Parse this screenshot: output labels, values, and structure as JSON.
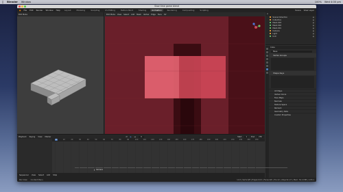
{
  "menubar": {
    "app": "Blender",
    "menu": "Window",
    "right": [
      "100%",
      "Wed 4:00 pm"
    ]
  },
  "window": {
    "title": "Slow time game blend"
  },
  "topbar": {
    "menus": [
      "File",
      "Edit",
      "Render",
      "Window",
      "Help"
    ],
    "workspaces": [
      "Layout",
      "Modeling",
      "Sculpting",
      "UV Editing",
      "Texture Paint",
      "Shading",
      "Animation",
      "Rendering",
      "Compositing",
      "Scripting"
    ],
    "active_workspace": "Animation",
    "scene": "Scene",
    "view_layer": "View Layer"
  },
  "leftview": {
    "mode": "Edit Mode"
  },
  "camview": {
    "mode": "Edit Mode",
    "menus": [
      "View",
      "Select",
      "Add",
      "Mesh",
      "Vertex",
      "Edge",
      "Face",
      "UV"
    ],
    "overlay_title": "Camera Perspective",
    "overlay_sub": "(0) Unit"
  },
  "outliner": {
    "items": [
      {
        "label": "Scene Collection",
        "green": false
      },
      {
        "label": "Collection",
        "green": false
      },
      {
        "label": "Mesh.003",
        "green": true
      },
      {
        "label": "Mesh.002",
        "green": true
      },
      {
        "label": "Mesh.001",
        "green": true
      },
      {
        "label": "Camera",
        "green": false
      },
      {
        "label": "Light",
        "green": false
      },
      {
        "label": "Unit",
        "green": true
      }
    ]
  },
  "props": {
    "object": "Cube",
    "data_name": "Base",
    "sections": [
      "Vertex Groups",
      "Shape Keys"
    ],
    "rows": [
      "UV Maps",
      "Vertex Colors",
      "Face Maps",
      "Normals",
      "Texture Space",
      "Remesh",
      "Geometry Data",
      "Custom Properties"
    ]
  },
  "timeline": {
    "menus": [
      "Playback",
      "Keying",
      "View",
      "Marker"
    ],
    "frame_current": "0",
    "start_label": "Start",
    "start": "1",
    "end_label": "End",
    "end": "250",
    "ticks": [
      "0",
      "10",
      "20",
      "30",
      "40",
      "50",
      "60",
      "70",
      "80",
      "90",
      "100",
      "110",
      "120",
      "130",
      "140",
      "150",
      "160",
      "170",
      "180",
      "190",
      "200",
      "210",
      "220",
      "230",
      "240",
      "250"
    ],
    "marker": "Camera"
  },
  "sequencer": {
    "label": "Sequencer",
    "menus": [
      "View",
      "Select",
      "Add",
      "Strip"
    ]
  },
  "statusbar": {
    "left": [
      "Pan View",
      "Context Menu"
    ],
    "right": "Unit | Verts:0/8 | Edges:0/12 | Faces:0/6 | Tris:12 | Objects:1/7 | Mem: 54.4 MiB | 2.83.1"
  },
  "colors": {
    "camera_bg": "#5a1a22",
    "accent": "#4d78b8",
    "selection": "#e89a3c"
  }
}
